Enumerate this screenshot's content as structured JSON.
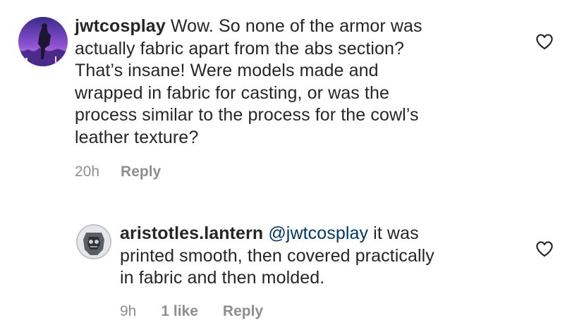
{
  "comments": [
    {
      "username": "jwtcosplay",
      "text_lines": [
        "Wow. So none of the armor was",
        "actually fabric apart from the abs section?",
        "That’s insane! Were models made and",
        "wrapped in fabric for casting, or was the",
        "process similar to the process for the cowl’s",
        "leather texture?"
      ],
      "time": "20h",
      "reply_label": "Reply",
      "like_icon": "heart-outline-icon"
    },
    {
      "username": "aristotles.lantern",
      "mention": "@jwtcosplay",
      "first_line_rest": "it was",
      "text_lines": [
        "printed smooth, then covered practically",
        "in fabric and then molded."
      ],
      "time": "9h",
      "likes": "1 like",
      "reply_label": "Reply",
      "like_icon": "heart-outline-icon"
    }
  ],
  "colors": {
    "text": "#262626",
    "meta": "#8e8e8e",
    "mention": "#00376b",
    "background": "#ffffff"
  }
}
